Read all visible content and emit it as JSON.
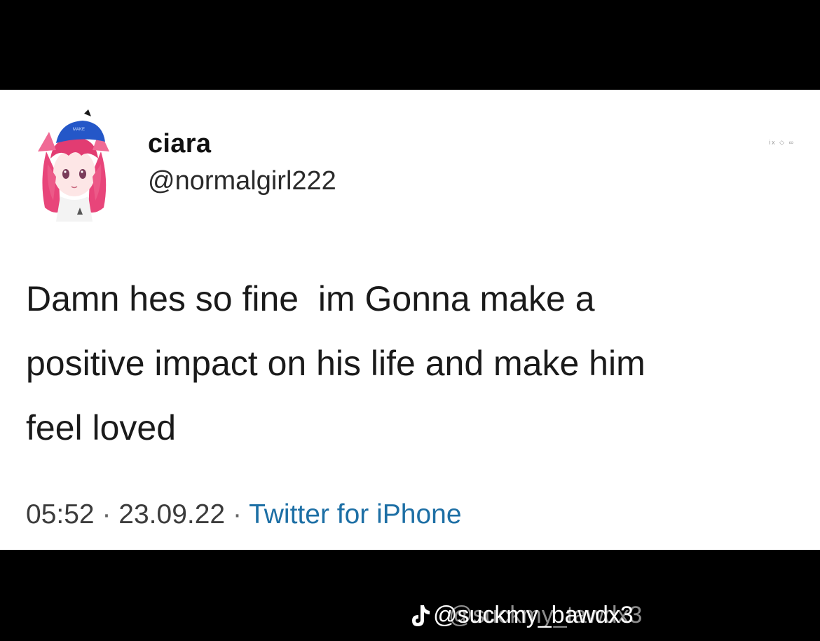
{
  "author": {
    "display_name": "ciara",
    "handle": "@normalgirl222",
    "avatar_icon": "anime-girl-avatar"
  },
  "corner_mark": "ix ◇ ∞",
  "tweet": {
    "text": "Damn hes so fine  im Gonna make a\npositive impact on his life and make him\nfeel loved"
  },
  "meta": {
    "time": "05:52",
    "separator": "·",
    "date": "23.09.22",
    "source": "Twitter for iPhone"
  },
  "watermark": {
    "icon": "tiktok-icon",
    "text": "@suckmy_bawdx3",
    "ghost_text": "@suckmy_tawdx3"
  },
  "colors": {
    "background": "#000000",
    "card": "#ffffff",
    "text": "#1a1a1a",
    "source_link": "#1d6fa5"
  }
}
